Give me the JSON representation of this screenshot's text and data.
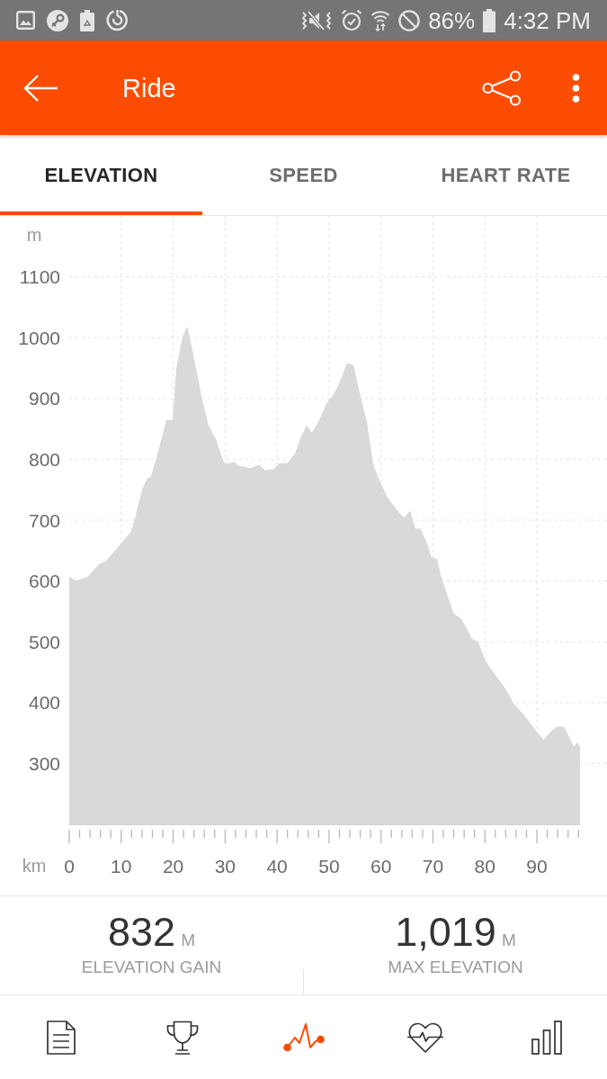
{
  "status_bar": {
    "battery": "86%",
    "time": "4:32 PM"
  },
  "app_bar": {
    "title": "Ride"
  },
  "tabs": [
    {
      "label": "ELEVATION",
      "selected": true
    },
    {
      "label": "SPEED",
      "selected": false
    },
    {
      "label": "HEART RATE",
      "selected": false
    }
  ],
  "chart": {
    "chart_data": {
      "type": "area",
      "xlabel": "km",
      "ylabel": "m",
      "x": [
        0,
        1.4,
        3.5,
        5.7,
        7.1,
        9.2,
        11.8,
        12.6,
        14,
        15,
        15.7,
        17,
        18.7,
        19.9,
        20.6,
        21.8,
        22.7,
        23.9,
        25.6,
        26.8,
        28.2,
        29.8,
        30.8,
        31.7,
        32.5,
        33.7,
        34.8,
        36.5,
        37.7,
        39.4,
        40.3,
        42,
        43.4,
        44.6,
        45.7,
        46.7,
        48.1,
        49.5,
        50.7,
        51.7,
        53.5,
        54.7,
        55.9,
        57.3,
        58.5,
        59.7,
        61.4,
        63.7,
        64.5,
        65.6,
        66.6,
        67.6,
        68.9,
        69.7,
        70.8,
        71.5,
        72.8,
        74,
        75.3,
        76.3,
        77.5,
        78.7,
        80.1,
        82.2,
        83.6,
        85.6,
        87.9,
        89.6,
        91.3,
        92.6,
        93.9,
        95.2,
        96.2,
        97.1,
        97.8,
        98.3
      ],
      "values": [
        607,
        601,
        607,
        627,
        633,
        654,
        680,
        701,
        750,
        769,
        771,
        809,
        865,
        865,
        949,
        1001,
        1019,
        971,
        898,
        856,
        834,
        794,
        793,
        796,
        790,
        788,
        785,
        791,
        782,
        784,
        793,
        794,
        809,
        837,
        856,
        844,
        864,
        892,
        905,
        920,
        958,
        955,
        909,
        861,
        791,
        765,
        735,
        710,
        704,
        716,
        686,
        686,
        661,
        639,
        636,
        610,
        576,
        546,
        539,
        525,
        505,
        500,
        469,
        443,
        428,
        398,
        376,
        356,
        339,
        352,
        361,
        360,
        344,
        327,
        335,
        326
      ],
      "xlim": [
        0,
        98.3
      ],
      "ylim": [
        200,
        1200
      ],
      "xticks": [
        0,
        10,
        20,
        30,
        40,
        50,
        60,
        70,
        80,
        90
      ],
      "yticks": [
        300,
        400,
        500,
        600,
        700,
        800,
        900,
        1000,
        1100
      ],
      "grid": true
    }
  },
  "stats": [
    {
      "value": "832",
      "unit": "M",
      "label": "ELEVATION GAIN"
    },
    {
      "value": "1,019",
      "unit": "M",
      "label": "MAX ELEVATION"
    }
  ],
  "bottom_nav": [
    {
      "selected": false
    },
    {
      "selected": false
    },
    {
      "selected": true
    },
    {
      "selected": false
    },
    {
      "selected": false
    }
  ]
}
